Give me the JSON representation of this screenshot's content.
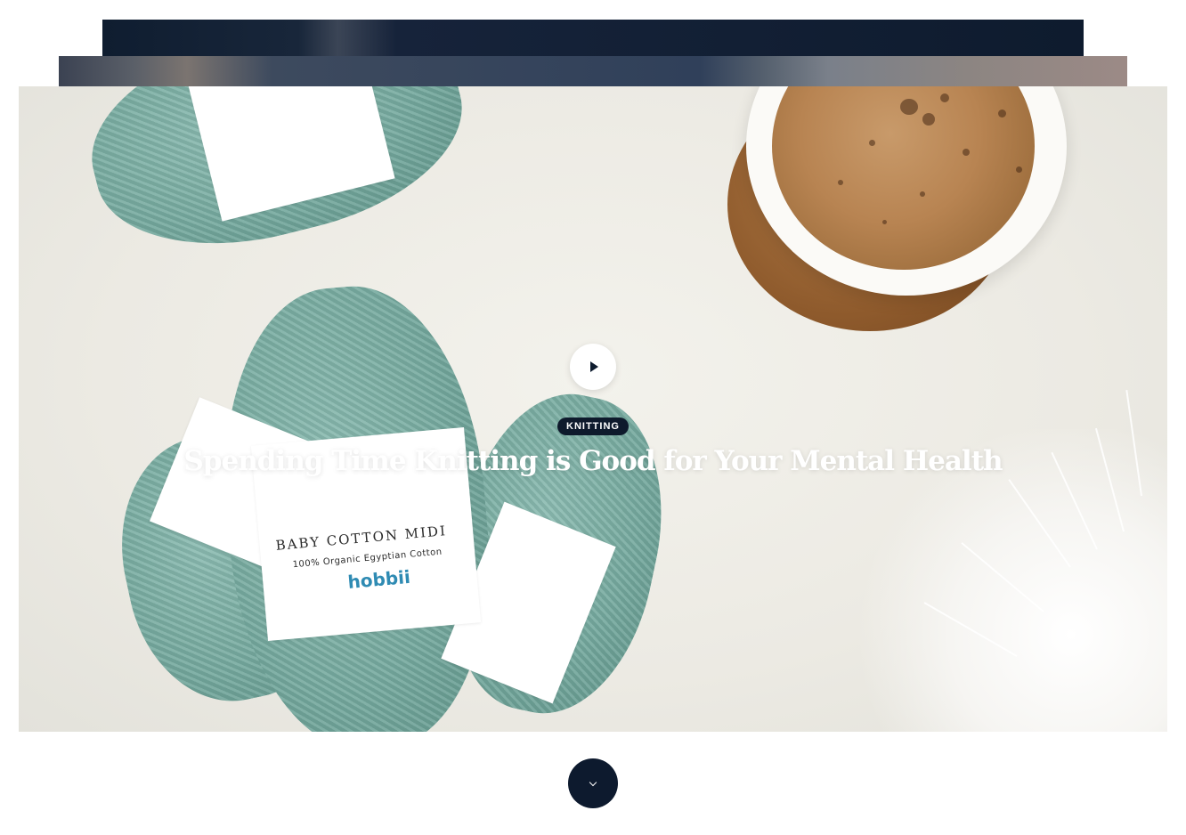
{
  "hero": {
    "category": "KNITTING",
    "title": "Spending Time Knitting is Good for Your Mental Health"
  },
  "yarn_labels": {
    "brand_line": "BABY COTTON MIDI",
    "sub_line": "100% Organic Egyptian Cotton",
    "brand": "hobbii"
  },
  "icons": {
    "play": "play-icon",
    "scroll": "chevron-down-icon"
  },
  "colors": {
    "accent_navy": "#0d1a2e",
    "white": "#ffffff",
    "yarn_teal": "#76aa9f"
  }
}
